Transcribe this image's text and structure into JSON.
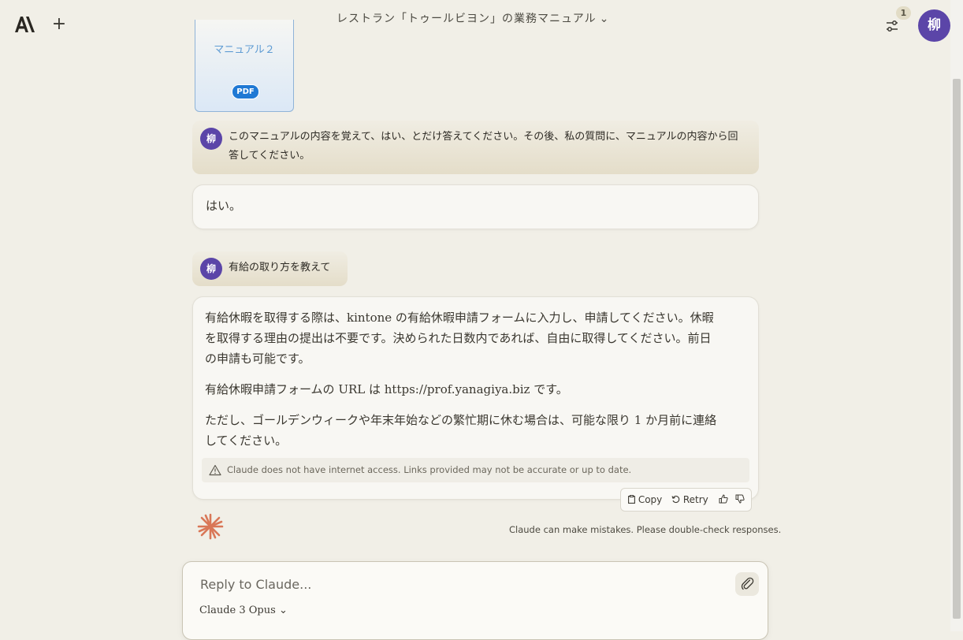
{
  "header": {
    "conversation_title": "レストラン「トゥールビヨン」の業務マニュアル",
    "notification_count": "1",
    "avatar_initial": "柳",
    "title_chevron": "⌄"
  },
  "attachment": {
    "name": "マニュアル２",
    "type_label": "PDF"
  },
  "messages": {
    "user_1": {
      "avatar": "柳",
      "text": "このマニュアルの内容を覚えて、はい、とだけ答えてください。その後、私の質問に、マニュアルの内容から回答してください。"
    },
    "assistant_1": {
      "text": "はい。"
    },
    "user_2": {
      "avatar": "柳",
      "text": "有給の取り方を教えて"
    },
    "assistant_2": {
      "paragraphs": [
        "有給休暇を取得する際は、kintone の有給休暇申請フォームに入力し、申請してください。休暇を取得する理由の提出は不要です。決められた日数内であれば、自由に取得してください。前日の申請も可能です。",
        "有給休暇申請フォームの URL は https://prof.yanagiya.biz です。",
        "ただし、ゴールデンウィークや年末年始などの繁忙期に休む場合は、可能な限り 1 か月前に連絡してください。"
      ],
      "warning": "Claude does not have internet access. Links provided may not be accurate or up to date."
    }
  },
  "message_actions": {
    "copy": "Copy",
    "retry": "Retry"
  },
  "disclaimer": "Claude can make mistakes. Please double-check responses.",
  "composer": {
    "placeholder": "Reply to Claude...",
    "model": "Claude 3 Opus",
    "model_chevron": "⌄"
  },
  "colors": {
    "background": "#f1efe7",
    "avatar": "#5b45a8",
    "claude_spark": "#d97757",
    "pdf_badge": "#2079d4"
  },
  "icons": [
    "anthropic-logo-icon",
    "plus-icon",
    "sliders-icon",
    "paperclip-icon",
    "warning-icon",
    "clipboard-icon",
    "retry-icon",
    "thumbs-up-icon",
    "thumbs-down-icon",
    "claude-spark-icon"
  ]
}
